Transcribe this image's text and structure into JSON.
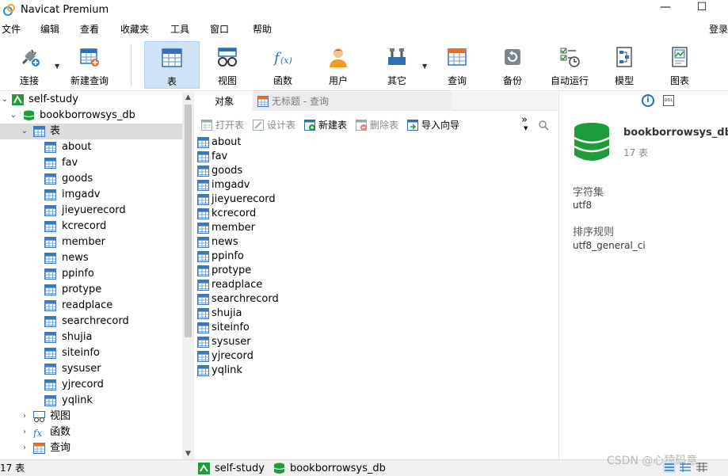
{
  "window": {
    "title": "Navicat Premium",
    "minimize": "—",
    "maximize": "☐"
  },
  "menu": {
    "items": [
      "文件",
      "编辑",
      "查看",
      "收藏夹",
      "工具",
      "窗口",
      "帮助"
    ],
    "login": "登录"
  },
  "toolbar": {
    "items": [
      {
        "label": "连接",
        "icon": "plug-icon"
      },
      {
        "label": "新建查询",
        "icon": "new-query-icon"
      },
      {
        "label": "表",
        "icon": "table-icon",
        "active": true
      },
      {
        "label": "视图",
        "icon": "view-icon"
      },
      {
        "label": "函数",
        "icon": "function-icon"
      },
      {
        "label": "用户",
        "icon": "user-icon"
      },
      {
        "label": "其它",
        "icon": "tools-icon"
      },
      {
        "label": "查询",
        "icon": "query-icon"
      },
      {
        "label": "备份",
        "icon": "backup-icon"
      },
      {
        "label": "自动运行",
        "icon": "schedule-icon"
      },
      {
        "label": "模型",
        "icon": "model-icon"
      },
      {
        "label": "图表",
        "icon": "chart-icon"
      }
    ]
  },
  "tree": {
    "connection": "self-study",
    "database": "bookborrowsys_db",
    "tables_folder": "表",
    "tables": [
      "about",
      "fav",
      "goods",
      "imgadv",
      "jieyuerecord",
      "kcrecord",
      "member",
      "news",
      "ppinfo",
      "protype",
      "readplace",
      "searchrecord",
      "shujia",
      "siteinfo",
      "sysuser",
      "yjrecord",
      "yqlink"
    ],
    "views_folder": "视图",
    "functions_folder": "函数",
    "queries_folder": "查询"
  },
  "center": {
    "tabs": {
      "objects": "对象",
      "query": "无标题 - 查询"
    },
    "actions": {
      "open": "打开表",
      "design": "设计表",
      "new": "新建表",
      "delete": "删除表",
      "import": "导入向导"
    },
    "more": "»",
    "objects": [
      "about",
      "fav",
      "goods",
      "imgadv",
      "jieyuerecord",
      "kcrecord",
      "member",
      "news",
      "ppinfo",
      "protype",
      "readplace",
      "searchrecord",
      "shujia",
      "siteinfo",
      "sysuser",
      "yjrecord",
      "yqlink"
    ]
  },
  "right_panel": {
    "db_name": "bookborrowsys_db",
    "table_count": "17 表",
    "charset_label": "字符集",
    "charset_value": "utf8",
    "collation_label": "排序规则",
    "collation_value": "utf8_general_ci",
    "info": "i",
    "ddl": "DDL"
  },
  "status": {
    "count": "17 表",
    "connection": "self-study",
    "database": "bookborrowsys_db"
  },
  "watermark": "CSDN @心猿码意",
  "colors": {
    "accent": "#2f7fd6",
    "db_green": "#1e9c3a",
    "active_tab": "#cfe3f8"
  }
}
